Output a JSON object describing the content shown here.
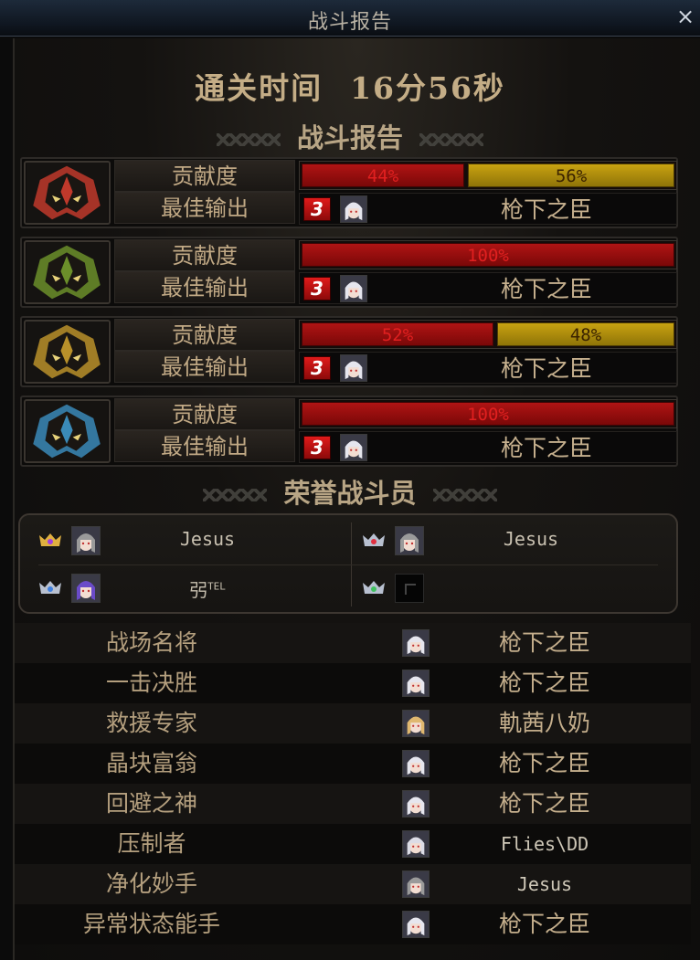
{
  "window": {
    "title": "战斗报告",
    "close_glyph": "×"
  },
  "clear_time": {
    "label": "通关时间",
    "value": "16分56秒"
  },
  "sections": {
    "battle_report": "战斗报告",
    "honor_fighters": "荣誉战斗员"
  },
  "labels": {
    "contribution": "贡献度",
    "best_output": "最佳输出"
  },
  "teams": [
    {
      "emblem": "red-flame-helmet",
      "accent": "#c0392b",
      "bars": [
        {
          "text": "44%",
          "value": 0.44,
          "color": "red"
        },
        {
          "text": "56%",
          "value": 0.56,
          "color": "gold"
        }
      ],
      "best": {
        "badge": "3",
        "name": "枪下之臣"
      }
    },
    {
      "emblem": "green-helmet",
      "accent": "#6b8f2a",
      "bars": [
        {
          "text": "100%",
          "value": 1.0,
          "color": "red"
        }
      ],
      "best": {
        "badge": "3",
        "name": "枪下之臣"
      }
    },
    {
      "emblem": "gold-horned-helmet",
      "accent": "#b8902a",
      "bars": [
        {
          "text": "52%",
          "value": 0.52,
          "color": "red"
        },
        {
          "text": "48%",
          "value": 0.48,
          "color": "gold"
        }
      ],
      "best": {
        "badge": "3",
        "name": "枪下之臣"
      }
    },
    {
      "emblem": "blue-crystal-helmet",
      "accent": "#3a8ab8",
      "bars": [
        {
          "text": "100%",
          "value": 1.0,
          "color": "red"
        }
      ],
      "best": {
        "badge": "3",
        "name": "枪下之臣"
      }
    }
  ],
  "honor": [
    {
      "crown": "gold-purple-gem",
      "name": "Jesus",
      "sup": "",
      "avatar": "gray-hair"
    },
    {
      "crown": "silver-red-gem",
      "name": "Jesus",
      "sup": "",
      "avatar": "gray-hair"
    },
    {
      "crown": "silver-blue-gem",
      "name": "弜",
      "sup": "TEL",
      "avatar": "purple-hair"
    },
    {
      "crown": "silver-green-gem",
      "name": "",
      "sup": "",
      "avatar": "empty"
    }
  ],
  "awards": [
    {
      "title": "战场名将",
      "name": "枪下之臣",
      "avatar": "white-hair"
    },
    {
      "title": "一击决胜",
      "name": "枪下之臣",
      "avatar": "white-hair"
    },
    {
      "title": "救援专家",
      "name": "軌茜八奶",
      "avatar": "blonde"
    },
    {
      "title": "晶块富翁",
      "name": "枪下之臣",
      "avatar": "white-hair"
    },
    {
      "title": "回避之神",
      "name": "枪下之臣",
      "avatar": "white-hair"
    },
    {
      "title": "压制者",
      "name": "Flies\\DD",
      "avatar": "white-hair-dark"
    },
    {
      "title": "净化妙手",
      "name": "Jesus",
      "avatar": "gray-hair"
    },
    {
      "title": "异常状态能手",
      "name": "枪下之臣",
      "avatar": "white-hair"
    }
  ]
}
